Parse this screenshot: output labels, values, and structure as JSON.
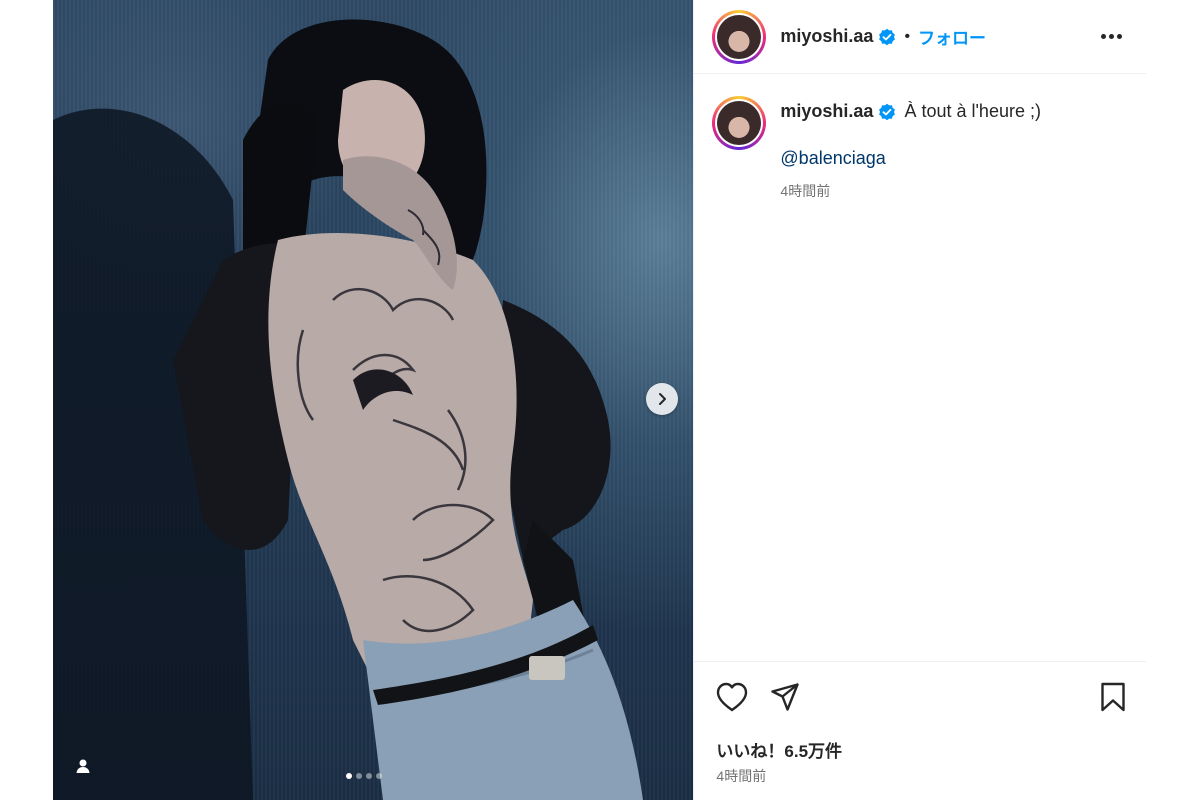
{
  "post": {
    "username": "miyoshi.aa",
    "follow_label": "フォロー",
    "separator": "•",
    "caption_text": "À tout à l'heure ;)",
    "mention": "@balenciaga",
    "caption_time": "4時間前",
    "likes": "いいね！6.5万件",
    "time": "4時間前"
  },
  "carousel": {
    "count": 4,
    "active_index": 0
  },
  "icons": {
    "verified": "verified-badge-icon",
    "more": "more-options-icon",
    "like": "heart-icon",
    "share": "paper-plane-icon",
    "save": "bookmark-icon",
    "next": "chevron-right-icon",
    "tag": "user-tag-icon"
  },
  "colors": {
    "link_blue": "#0095f6",
    "mention_blue": "#00376b",
    "verified_blue": "#0095f6",
    "muted_text": "#737373"
  }
}
